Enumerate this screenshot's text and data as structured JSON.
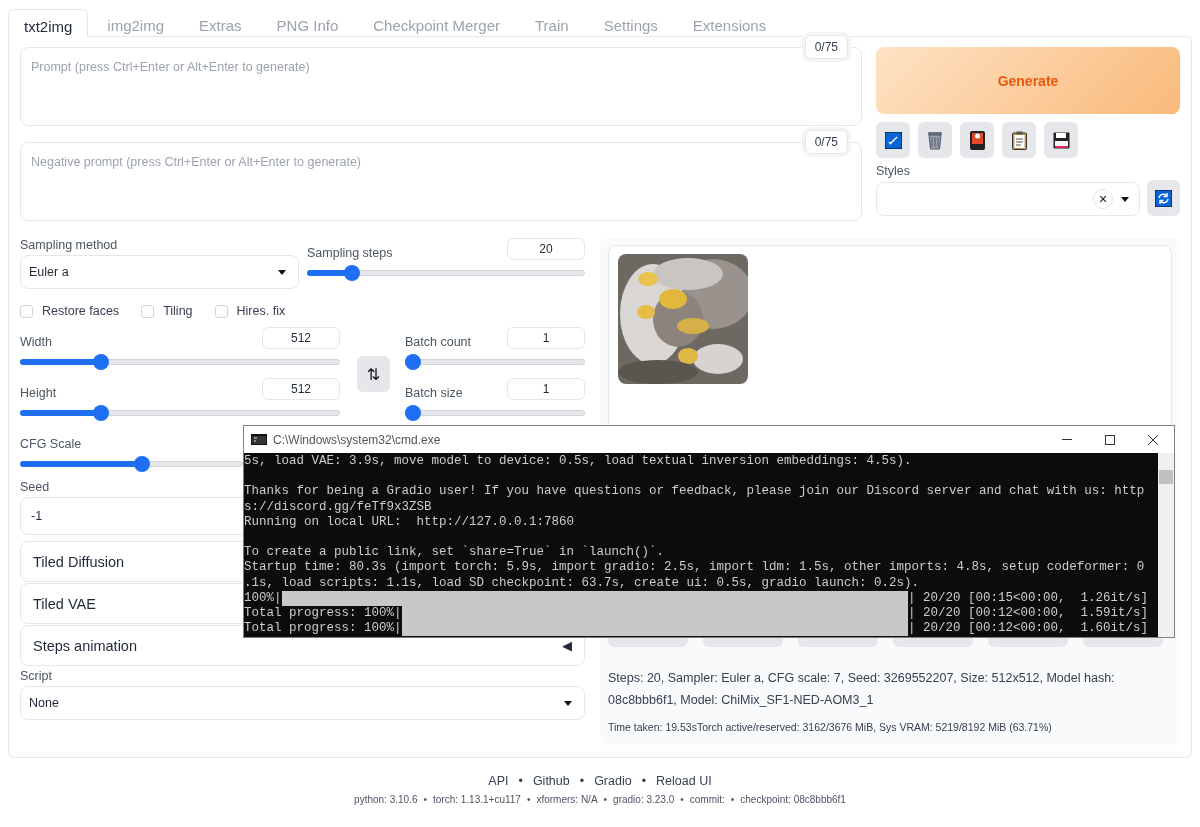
{
  "tabs": [
    {
      "label": "txt2img",
      "selected": true
    },
    {
      "label": "img2img",
      "selected": false
    },
    {
      "label": "Extras",
      "selected": false
    },
    {
      "label": "PNG Info",
      "selected": false
    },
    {
      "label": "Checkpoint Merger",
      "selected": false
    },
    {
      "label": "Train",
      "selected": false
    },
    {
      "label": "Settings",
      "selected": false
    },
    {
      "label": "Extensions",
      "selected": false
    }
  ],
  "prompt": {
    "placeholder": "Prompt (press Ctrl+Enter or Alt+Enter to generate)",
    "token_count": "0/75"
  },
  "negative_prompt": {
    "placeholder": "Negative prompt (press Ctrl+Enter or Alt+Enter to generate)",
    "token_count": "0/75"
  },
  "generate_button": "Generate",
  "styles": {
    "label": "Styles",
    "clear": "×"
  },
  "sampling_method": {
    "label": "Sampling method",
    "value": "Euler a"
  },
  "sampling_steps": {
    "label": "Sampling steps",
    "value": "20",
    "level": 0.14
  },
  "checkboxes": [
    {
      "label": "Restore faces",
      "checked": false
    },
    {
      "label": "Tiling",
      "checked": false
    },
    {
      "label": "Hires. fix",
      "checked": false
    }
  ],
  "width": {
    "label": "Width",
    "value": "512",
    "level": 0.24
  },
  "height": {
    "label": "Height",
    "value": "512",
    "level": 0.24
  },
  "batch_count": {
    "label": "Batch count",
    "value": "1",
    "level": 0
  },
  "batch_size": {
    "label": "Batch size",
    "value": "1",
    "level": 0
  },
  "swap_button": "⇅",
  "cfg_scale": {
    "label": "CFG Scale",
    "level": 0.55
  },
  "seed": {
    "label": "Seed",
    "value": "-1"
  },
  "accordions": [
    {
      "label": "Tiled Diffusion"
    },
    {
      "label": "Tiled VAE"
    },
    {
      "label": "Steps animation",
      "arrow": "◀"
    }
  ],
  "script": {
    "label": "Script",
    "value": "None"
  },
  "gallery": {
    "info": "Steps: 20, Sampler: Euler a, CFG scale: 7, Seed: 3269552207, Size: 512x512, Model hash: 08c8bbb6f1, Model: ChiMix_SF1-NED-AOM3_1",
    "time_taken": "Time taken: 19.53sTorch active/reserved: 3162/3676 MiB, Sys VRAM: 5219/8192 MiB (63.71%)"
  },
  "console": {
    "title": "C:\\Windows\\system32\\cmd.exe",
    "lines": [
      {
        "kind": "text",
        "text": "5s, load VAE: 3.9s, move model to device: 0.5s, load textual inversion embeddings: 4.5s)."
      },
      {
        "kind": "blank"
      },
      {
        "kind": "text",
        "text": "Thanks for being a Gradio user! If you have questions or feedback, please join our Discord server and chat with us: http"
      },
      {
        "kind": "text",
        "text": "s://discord.gg/feTf9x3ZSB"
      },
      {
        "kind": "text",
        "text": "Running on local URL:  http://127.0.0.1:7860"
      },
      {
        "kind": "blank"
      },
      {
        "kind": "text",
        "text": "To create a public link, set `share=True` in `launch()`."
      },
      {
        "kind": "text",
        "text": "Startup time: 80.3s (import torch: 5.9s, import gradio: 2.5s, import ldm: 1.5s, other imports: 4.8s, setup codeformer: 0"
      },
      {
        "kind": "text",
        "text": ".1s, load scripts: 1.1s, load SD checkpoint: 63.7s, create ui: 0.5s, gradio launch: 0.2s)."
      },
      {
        "kind": "progress",
        "prefix": "100%|",
        "level": 1,
        "suffix": "| 20/20 [00:15<00:00,  1.26it/s]"
      },
      {
        "kind": "progress",
        "prefix": "Total progress: 100%|",
        "level": 1,
        "suffix": "| 20/20 [00:12<00:00,  1.59it/s]"
      },
      {
        "kind": "progress",
        "prefix": "Total progress: 100%|",
        "level": 1,
        "suffix": "| 20/20 [00:12<00:00,  1.60it/s]"
      }
    ]
  },
  "footer": {
    "separator": "•",
    "links": [
      "API",
      "Github",
      "Gradio",
      "Reload UI"
    ],
    "versions": [
      "python: 3.10.6",
      "torch: 1.13.1+cu117",
      "xformers: N/A",
      "gradio: 3.23.0",
      "commit:",
      "checkpoint: 08c8bbb6f1"
    ]
  }
}
